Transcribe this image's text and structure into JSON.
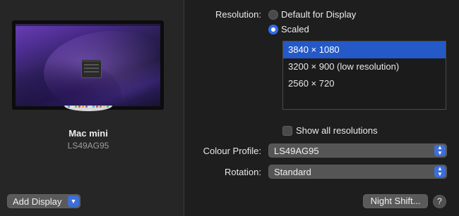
{
  "device": {
    "name": "Mac mini",
    "model": "LS49AG95"
  },
  "add_display": {
    "label": "Add Display",
    "icon": "chevron-down-icon"
  },
  "resolution": {
    "label": "Resolution:",
    "options": [
      {
        "label": "Default for Display",
        "selected": false
      },
      {
        "label": "Scaled",
        "selected": true
      }
    ],
    "list": [
      {
        "label": "3840 × 1080",
        "selected": true
      },
      {
        "label": "3200 × 900 (low resolution)",
        "selected": false
      },
      {
        "label": "2560 × 720",
        "selected": false
      }
    ]
  },
  "show_all": {
    "label": "Show all resolutions",
    "checked": false
  },
  "colour_profile": {
    "label": "Colour Profile:",
    "value": "LS49AG95"
  },
  "rotation": {
    "label": "Rotation:",
    "value": "Standard"
  },
  "night_shift": {
    "label": "Night Shift..."
  },
  "help": {
    "label": "?"
  },
  "colors": {
    "accent": "#2f6de6",
    "selection": "#2459c7",
    "background": "#1e1e1e"
  }
}
